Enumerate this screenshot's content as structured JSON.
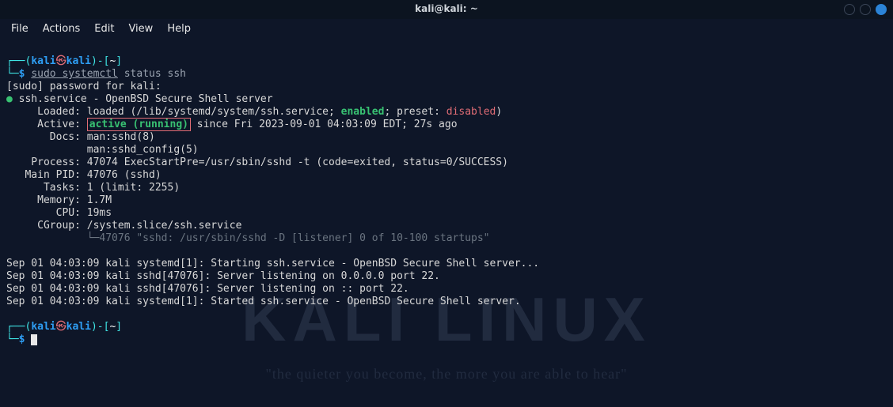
{
  "window": {
    "title": "kali@kali: ~"
  },
  "menu": {
    "file": "File",
    "actions": "Actions",
    "edit": "Edit",
    "view": "View",
    "help": "Help"
  },
  "prompt": {
    "user": "kali",
    "host": "kali",
    "sep": "㉿",
    "home": "~",
    "cmd_lead": "$ ",
    "cmd": "sudo systemctl",
    "cmd_sudo": "sudo",
    "cmd_rest": " systemctl status ssh",
    "status_args": " status ssh"
  },
  "out": {
    "sudo_pw": "[sudo] password for kali:",
    "unit": "ssh.service - OpenBSD Secure Shell server",
    "loaded_lbl": "     Loaded: ",
    "loaded_val": "loaded (/lib/systemd/system/ssh.service; ",
    "enabled": "enabled",
    "loaded_mid": "; preset: ",
    "disabled": "disabled",
    "loaded_end": ")",
    "active_lbl": "     Active: ",
    "active_val": "active (running)",
    "active_since": " since Fri 2023-09-01 04:03:09 EDT; 27s ago",
    "docs_lbl": "       Docs: ",
    "docs1": "man:sshd(8)",
    "docs2": "             man:sshd_config(5)",
    "process": "    Process: 47074 ExecStartPre=/usr/sbin/sshd -t (code=exited, status=0/SUCCESS)",
    "mainpid": "   Main PID: 47076 (sshd)",
    "tasks": "      Tasks: 1 (limit: 2255)",
    "memory": "     Memory: 1.7M",
    "cpu": "        CPU: 19ms",
    "cgroup": "     CGroup: /system.slice/ssh.service",
    "cgroup_child": "             └─47076 \"sshd: /usr/sbin/sshd -D [listener] 0 of 10-100 startups\"",
    "log1": "Sep 01 04:03:09 kali systemd[1]: Starting ssh.service - OpenBSD Secure Shell server...",
    "log2": "Sep 01 04:03:09 kali sshd[47076]: Server listening on 0.0.0.0 port 22.",
    "log3": "Sep 01 04:03:09 kali sshd[47076]: Server listening on :: port 22.",
    "log4": "Sep 01 04:03:09 kali systemd[1]: Started ",
    "log4b": "ssh.service - OpenBSD Secure Shell server",
    "log4c": "."
  },
  "watermark": {
    "big": "KALI LINUX",
    "tag": "\"the quieter you become, the more you are able to hear\""
  }
}
